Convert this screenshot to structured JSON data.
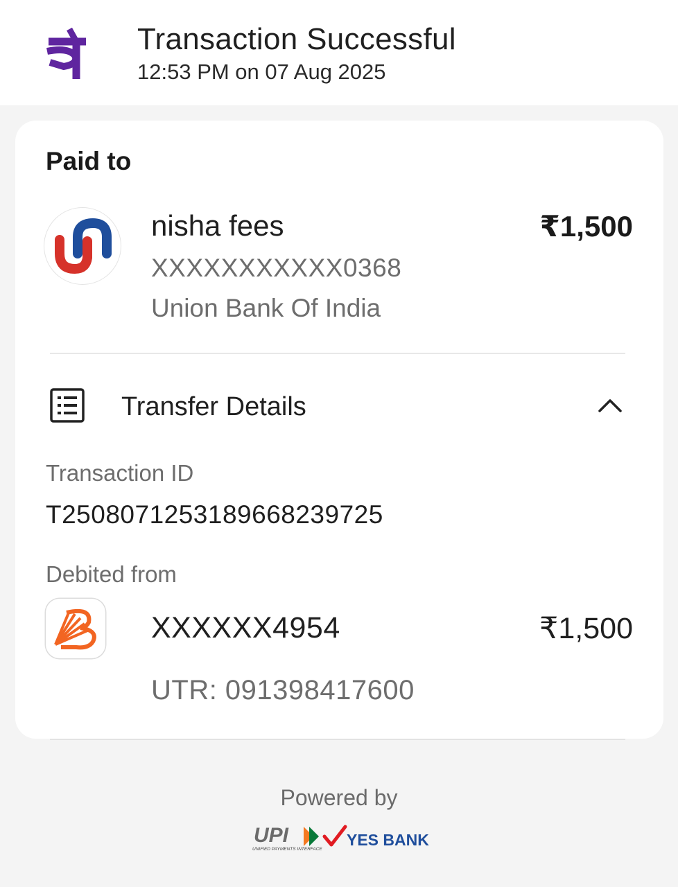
{
  "header": {
    "logo_icon": "phonepe-logo",
    "title": "Transaction Successful",
    "time": "12:53 PM on 07 Aug 2025"
  },
  "paid_to": {
    "heading": "Paid to",
    "bank_logo_icon": "union-bank-logo",
    "name": "nisha fees",
    "account": "XXXXXXXXXXX0368",
    "bank": "Union Bank Of India",
    "amount": "₹1,500"
  },
  "transfer_details": {
    "icon": "list-icon",
    "label": "Transfer Details",
    "toggle_icon": "chevron-up-icon",
    "transaction_id_label": "Transaction ID",
    "transaction_id": "T2508071253189668239725",
    "debited_from_label": "Debited from",
    "debit_bank_logo_icon": "bank-of-baroda-logo",
    "debit_account": "XXXXXX4954",
    "debit_amount": "₹1,500",
    "utr": "UTR: 091398417600"
  },
  "footer": {
    "powered_by": "Powered by",
    "upi_text": "UPI",
    "upi_subtext": "UNIFIED PAYMENTS INTERFACE",
    "bank_text": "YES BANK"
  },
  "colors": {
    "brand_purple": "#5f259f",
    "union_red": "#d6322a",
    "union_blue": "#1f4e9c",
    "bob_orange": "#f26522"
  }
}
